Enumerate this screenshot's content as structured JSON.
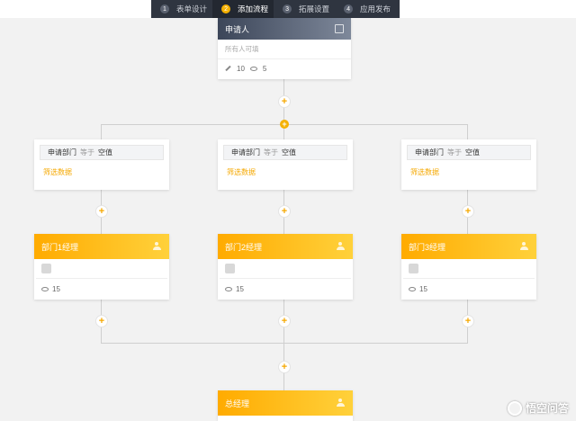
{
  "steps": [
    {
      "num": "1",
      "label": "表单设计"
    },
    {
      "num": "2",
      "label": "添加流程"
    },
    {
      "num": "3",
      "label": "拓展设置"
    },
    {
      "num": "4",
      "label": "应用发布"
    }
  ],
  "active_step": "2",
  "applicant": {
    "title": "申请人",
    "subtitle": "所有人可填",
    "edit_count": "10",
    "view_count": "5"
  },
  "branches": [
    {
      "filter_field": "申请部门",
      "filter_op": "等于",
      "filter_value": "空值",
      "filter_link": "筛选数据",
      "approver": "部门1经理",
      "view_count": "15"
    },
    {
      "filter_field": "申请部门",
      "filter_op": "等于",
      "filter_value": "空值",
      "filter_link": "筛选数据",
      "approver": "部门2经理",
      "view_count": "15"
    },
    {
      "filter_field": "申请部门",
      "filter_op": "等于",
      "filter_value": "空值",
      "filter_link": "筛选数据",
      "approver": "部门3经理",
      "view_count": "15"
    }
  ],
  "final": {
    "title": "总经理"
  },
  "add_symbol": "+",
  "watermark": {
    "text": "悟空问答"
  },
  "colors": {
    "accent": "#f5b100",
    "header_dark": "#3c4659",
    "step_bar": "#2f3540"
  }
}
